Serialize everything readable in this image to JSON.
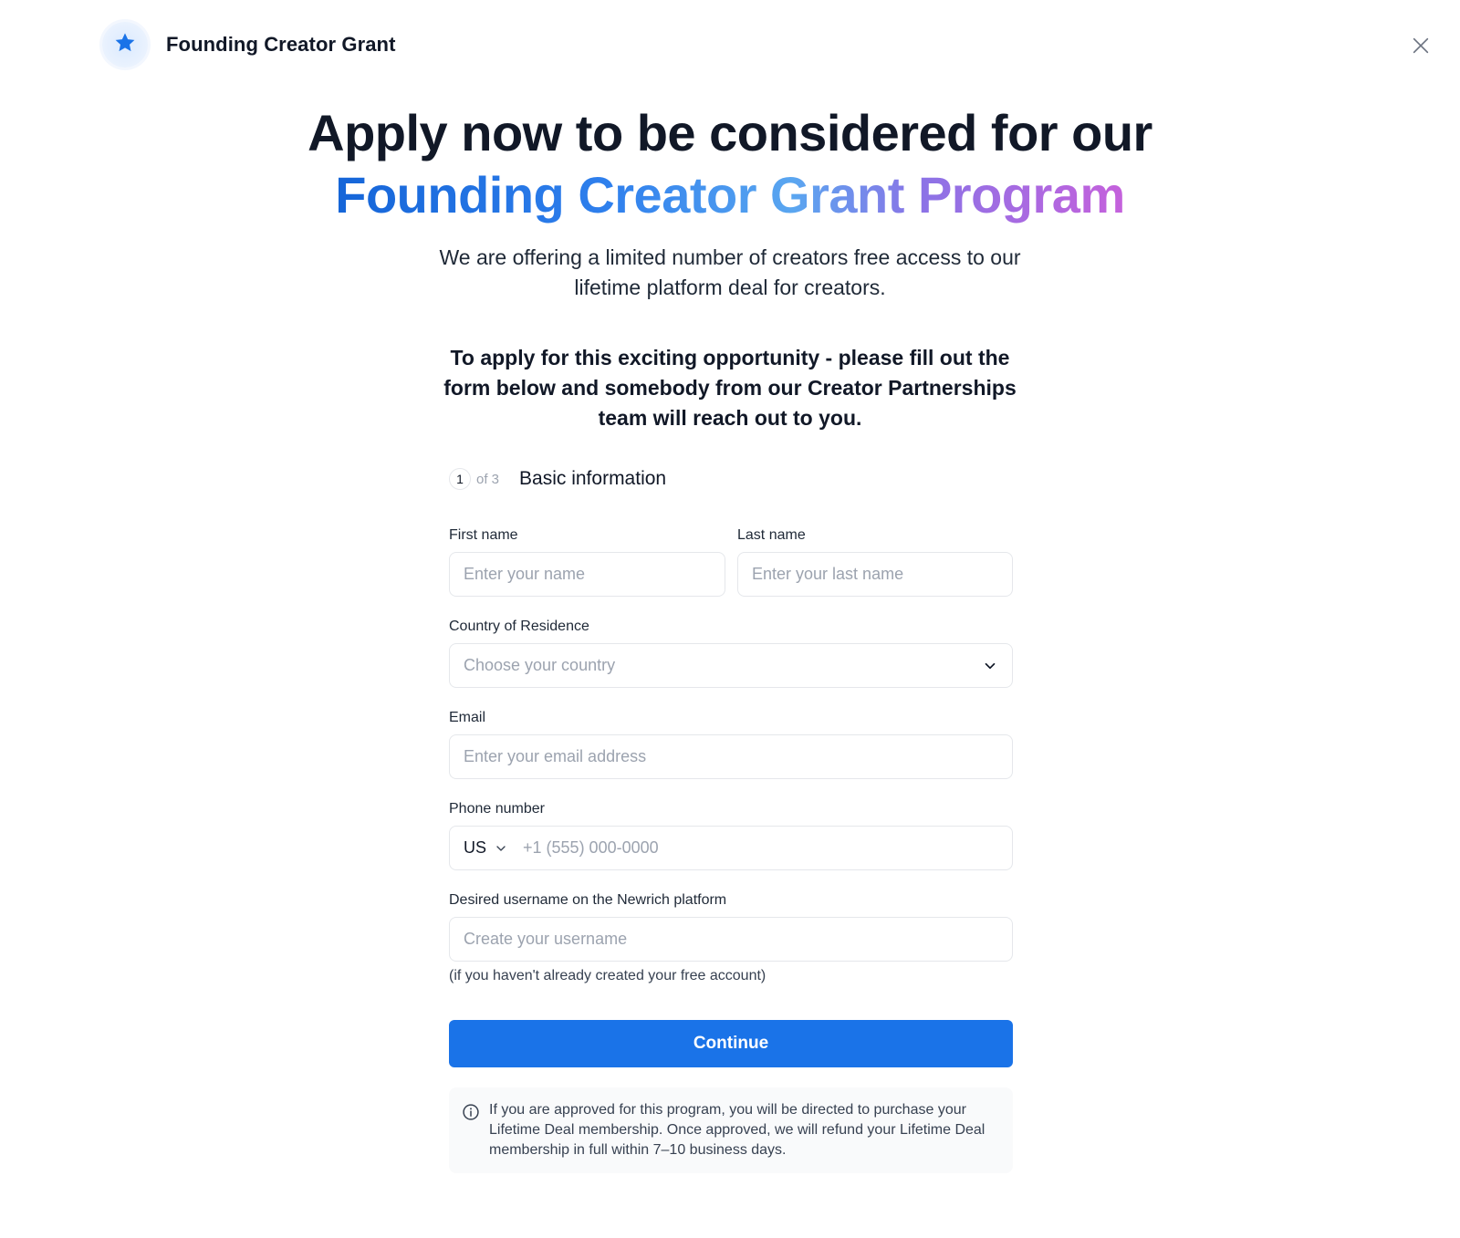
{
  "header": {
    "app_title": "Founding Creator Grant",
    "logo_icon": "star-icon",
    "close_icon": "close-icon",
    "accent_color": "#1a73e8"
  },
  "hero": {
    "headline_line1": "Apply now to be considered for our",
    "headline_line2": "Founding Creator Grant Program",
    "subtitle": "We are offering a limited number of creators free access to our lifetime platform deal for creators.",
    "instructions": "To apply for this exciting opportunity - please fill out the form below and somebody from our Creator Partnerships team will reach out to you."
  },
  "step": {
    "current": "1",
    "of_label": "of 3",
    "title": "Basic information"
  },
  "form": {
    "first_name": {
      "label": "First name",
      "placeholder": "Enter your name",
      "value": ""
    },
    "last_name": {
      "label": "Last name",
      "placeholder": "Enter your last name",
      "value": ""
    },
    "country": {
      "label": "Country of Residence",
      "placeholder": "Choose your country"
    },
    "email": {
      "label": "Email",
      "placeholder": "Enter your email address",
      "value": ""
    },
    "phone": {
      "label": "Phone number",
      "country_code": "US",
      "placeholder": "+1 (555) 000-0000",
      "value": ""
    },
    "username": {
      "label": "Desired username on the Newrich platform",
      "placeholder": "Create your username",
      "value": "",
      "help": "(if you haven't already created your free account)"
    },
    "continue_label": "Continue"
  },
  "notice": {
    "icon": "info-icon",
    "text": "If you are approved for this program, you will be directed to purchase your Lifetime Deal membership. Once approved, we will refund your Lifetime Deal membership in full within 7–10 business days."
  }
}
